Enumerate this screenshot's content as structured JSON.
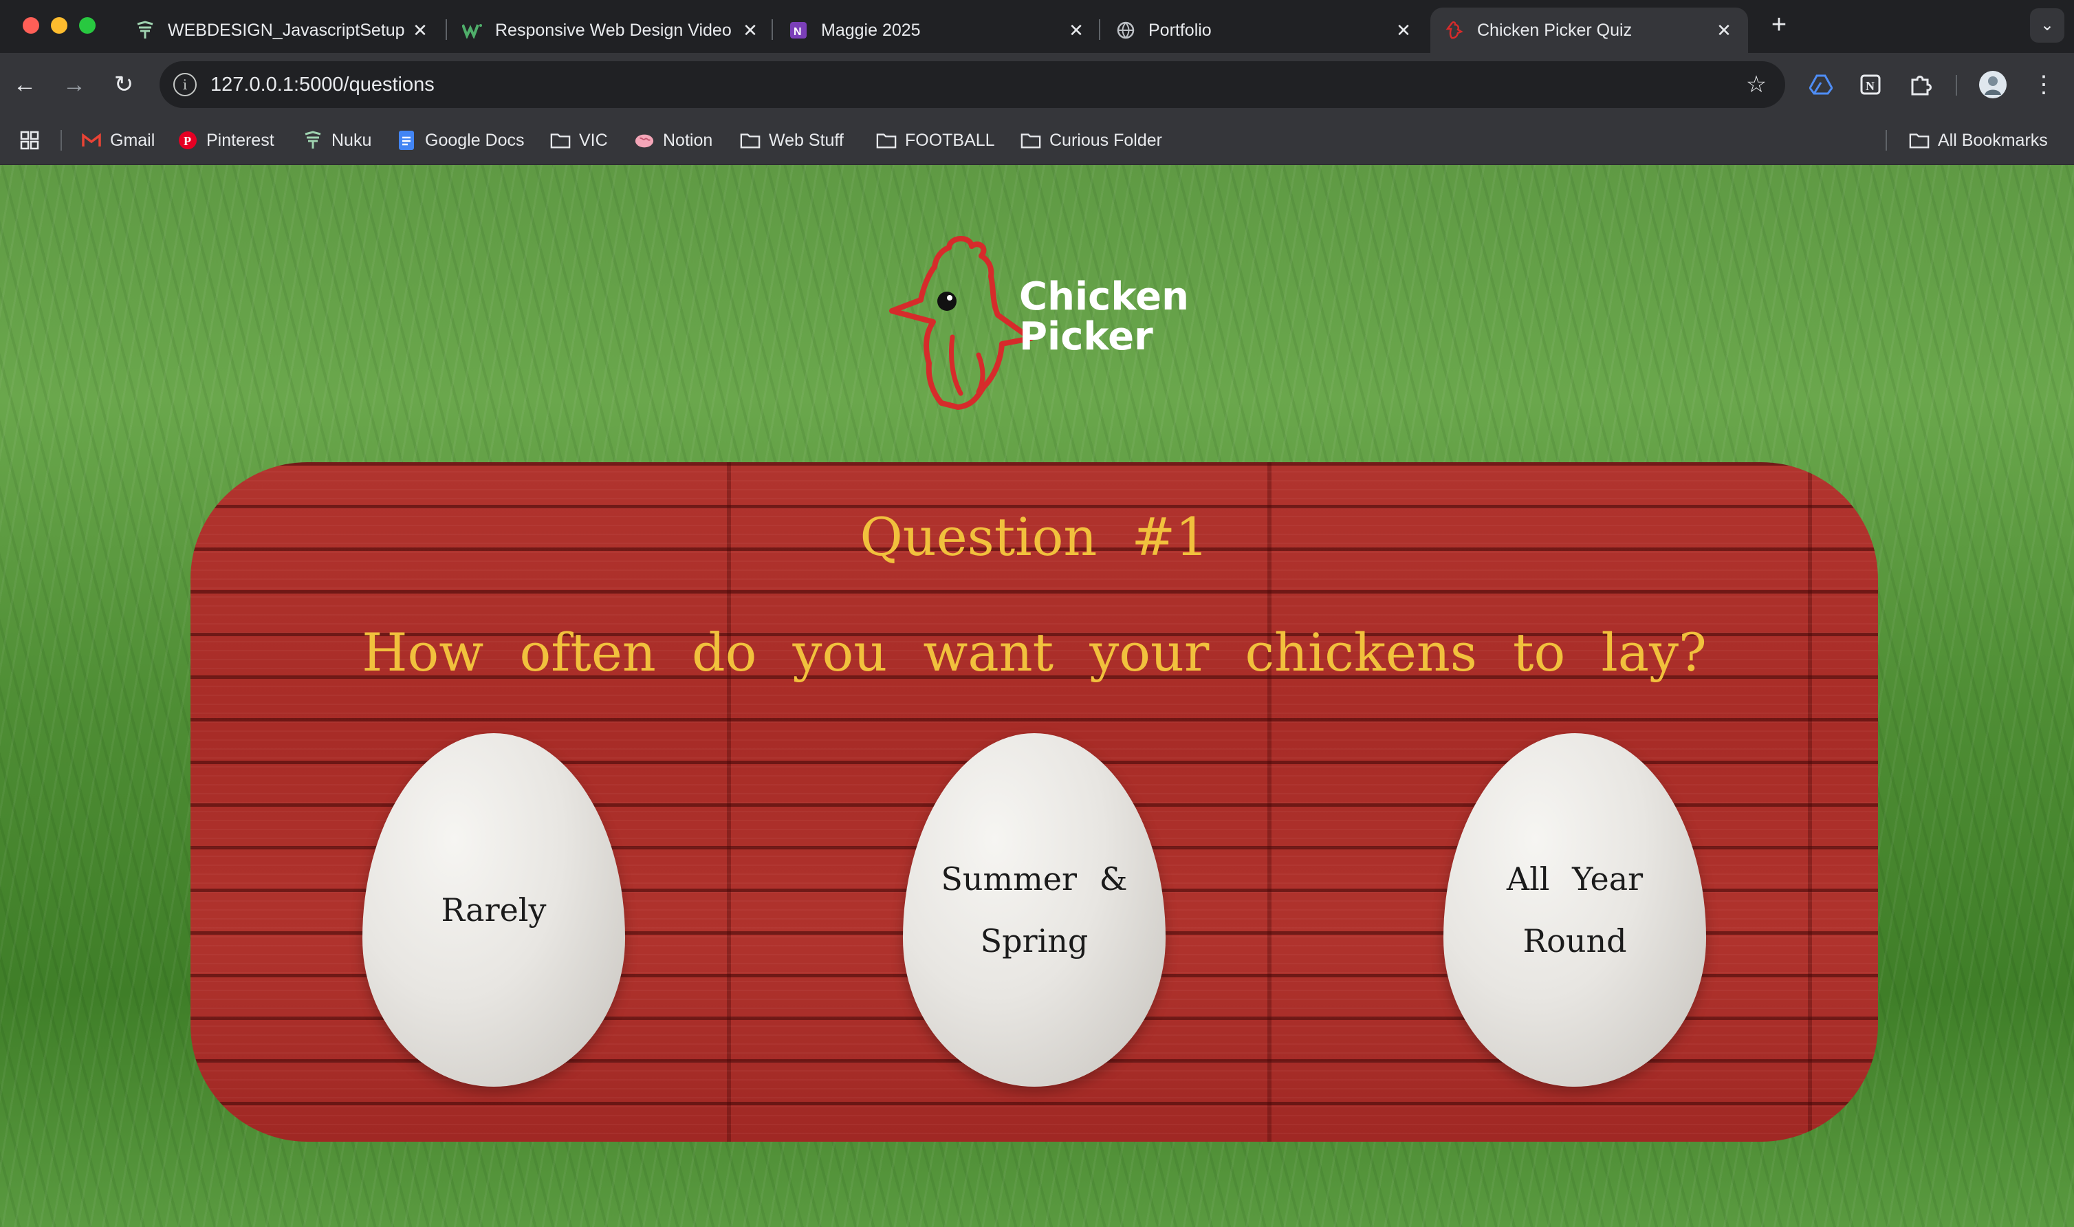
{
  "browser": {
    "tabs": [
      {
        "title": "WEBDESIGN_JavascriptSetup",
        "active": false,
        "icon": "nuku-logo-icon"
      },
      {
        "title": "Responsive Web Design Video",
        "active": false,
        "icon": "webflow-icon"
      },
      {
        "title": "Maggie 2025",
        "active": false,
        "icon": "onenote-icon"
      },
      {
        "title": "Portfolio",
        "active": false,
        "icon": "globe-icon"
      },
      {
        "title": "Chicken Picker Quiz",
        "active": true,
        "icon": "chicken-icon"
      }
    ],
    "url": "127.0.0.1:5000/questions",
    "bookmarks": [
      {
        "label": "Gmail",
        "icon": "gmail-icon"
      },
      {
        "label": "Pinterest",
        "icon": "pinterest-icon"
      },
      {
        "label": "Nuku",
        "icon": "nuku-logo-icon"
      },
      {
        "label": "Google Docs",
        "icon": "google-docs-icon"
      },
      {
        "label": "VIC",
        "icon": "folder-icon"
      },
      {
        "label": "Notion",
        "icon": "brain-icon"
      },
      {
        "label": "Web Stuff",
        "icon": "folder-icon"
      },
      {
        "label": "FOOTBALL",
        "icon": "folder-icon"
      },
      {
        "label": "Curious Folder",
        "icon": "folder-icon"
      }
    ],
    "all_bookmarks_label": "All Bookmarks"
  },
  "logo": {
    "line1": "Chicken",
    "line2": "Picker"
  },
  "quiz": {
    "question_number": "Question #1",
    "question_text": "How often do you want your chickens to lay?",
    "options": [
      "Rarely",
      "Summer & Spring",
      "All Year Round"
    ]
  },
  "colors": {
    "accent_text": "#f1c13d",
    "barn_red": "#a82c27",
    "logo_red": "#d62b2b",
    "grass_green": "#5a9a40"
  }
}
